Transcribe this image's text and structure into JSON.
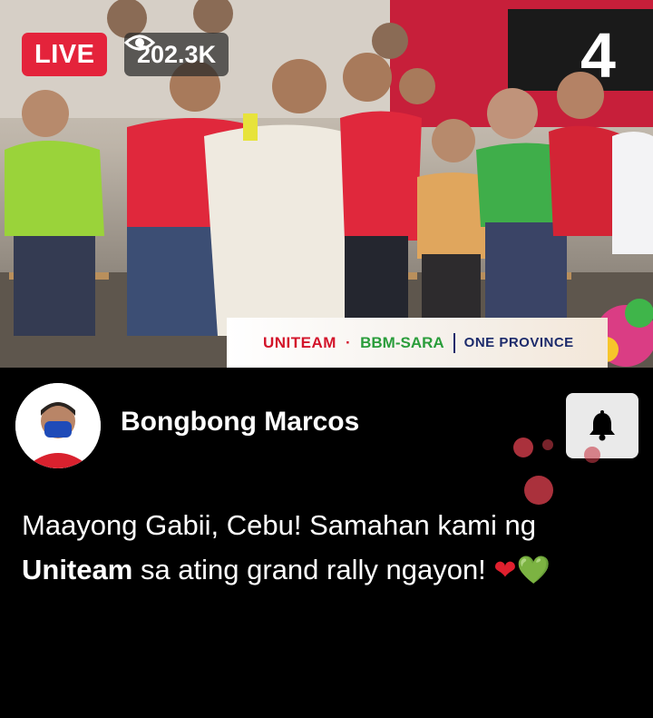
{
  "stream": {
    "live_label": "LIVE",
    "viewer_count": "202.3K",
    "banner": {
      "part1": "UNITEAM",
      "dot": "·",
      "part2": "BBM-SARA",
      "part3": "ONE PROVINCE"
    }
  },
  "profile": {
    "name": "Bongbong Marcos"
  },
  "caption": {
    "line1": "Maayong Gabii, Cebu! Samahan kami ng",
    "bold_word": "Uniteam",
    "line2_rest": "sa ating grand rally ngayon!",
    "emoji_red_heart": "❤",
    "emoji_green_heart": "💚"
  },
  "icons": {
    "viewer": "eye-icon",
    "notification": "bell-icon"
  },
  "colors": {
    "live_red": "#e4233b",
    "background": "#000000",
    "bell_button": "#eaeaea"
  }
}
